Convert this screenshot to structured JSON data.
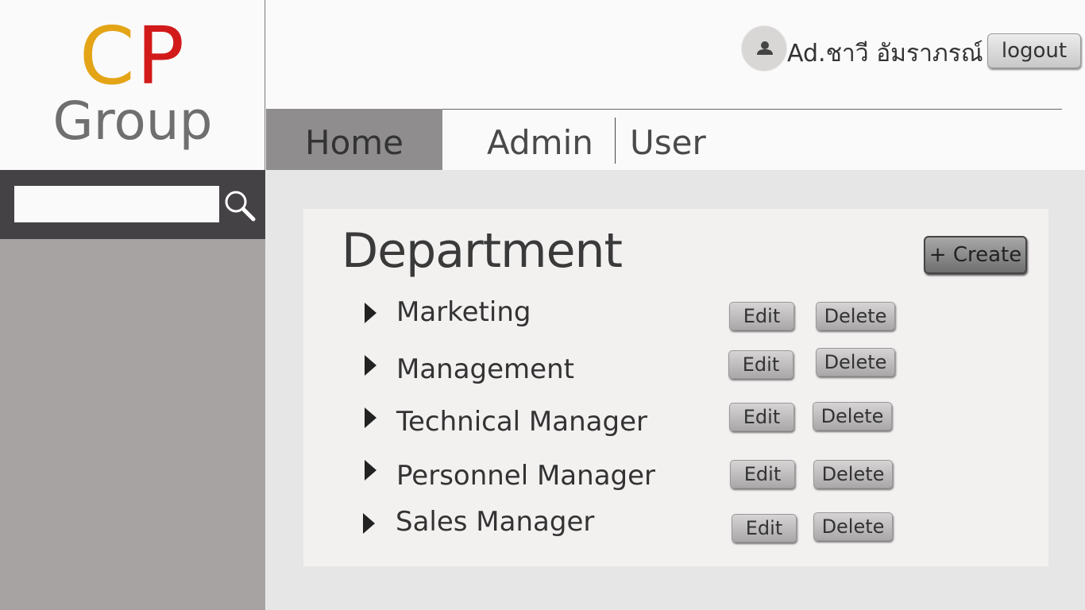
{
  "logo": {
    "letter_c": "C",
    "letter_p": "P",
    "group": "Group"
  },
  "search": {
    "value": "",
    "placeholder": ""
  },
  "user": {
    "name": "Ad.ชาวี อัมราภรณ์",
    "logout_label": "logout"
  },
  "nav": {
    "tabs": [
      {
        "label": "Home",
        "active": true
      },
      {
        "label": "Admin",
        "active": false
      },
      {
        "label": "User",
        "active": false
      }
    ]
  },
  "panel": {
    "title": "Department",
    "create_label": "+ Create",
    "departments": [
      {
        "name": "Marketing",
        "edit_label": "Edit",
        "delete_label": "Delete"
      },
      {
        "name": "Management",
        "edit_label": "Edit",
        "delete_label": "Delete"
      },
      {
        "name": "Technical Manager",
        "edit_label": "Edit",
        "delete_label": "Delete"
      },
      {
        "name": "Personnel Manager",
        "edit_label": "Edit",
        "delete_label": "Delete"
      },
      {
        "name": "Sales Manager",
        "edit_label": "Edit",
        "delete_label": "Delete"
      }
    ]
  },
  "icons": {
    "search": "search-icon",
    "avatar": "user-icon",
    "expand": "triangle-right-icon"
  },
  "colors": {
    "logo_c": "#e3a416",
    "logo_p": "#d21a1a",
    "logo_group": "#6f6f6f",
    "sidebar": "#a8a3a3",
    "search_bar": "#444244",
    "active_tab": "#8f8d8d"
  }
}
